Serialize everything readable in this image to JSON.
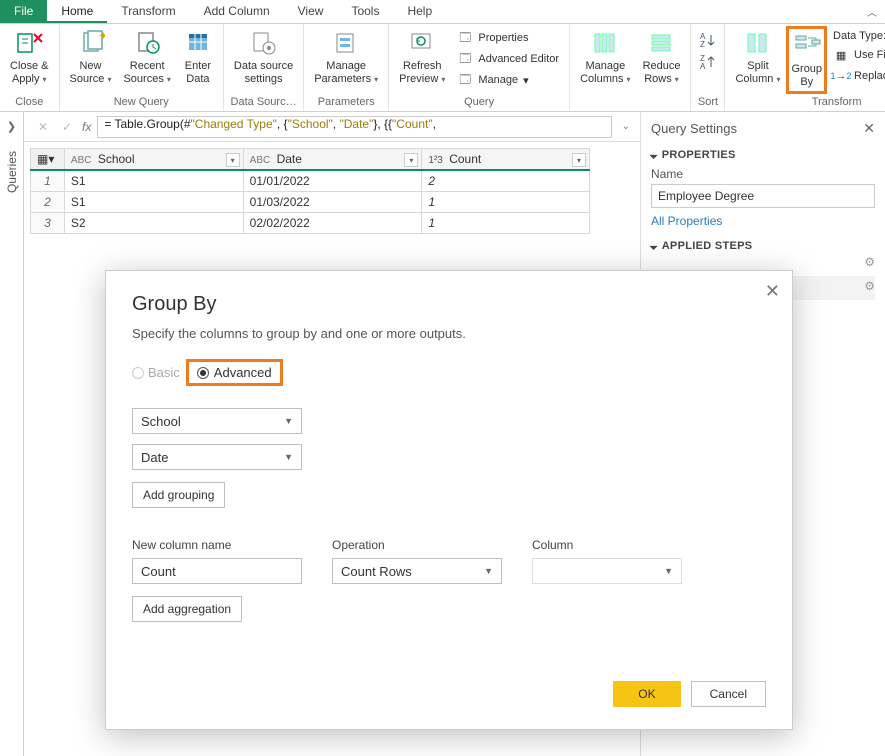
{
  "tabs": {
    "file": "File",
    "items": [
      "Home",
      "Transform",
      "Add Column",
      "View",
      "Tools",
      "Help"
    ],
    "active": 0
  },
  "ribbon": {
    "close": {
      "label1": "Close &",
      "label2": "Apply",
      "drop": "▾"
    },
    "close_group": "Close",
    "new": {
      "label1": "New",
      "label2": "Source",
      "drop": "▾"
    },
    "recent": {
      "label1": "Recent",
      "label2": "Sources",
      "drop": "▾"
    },
    "enter": {
      "label1": "Enter",
      "label2": "Data"
    },
    "newquery_group": "New Query",
    "datasource": {
      "label1": "Data source",
      "label2": "settings"
    },
    "ds_group": "Data Sourc…",
    "params": {
      "label1": "Manage",
      "label2": "Parameters",
      "drop": "▾"
    },
    "params_group": "Parameters",
    "preview": {
      "label1": "Refresh",
      "label2": "Preview",
      "drop": "▾"
    },
    "q_items": {
      "properties": "Properties",
      "advanced": "Advanced Editor",
      "manage": "Manage",
      "drop": "▾"
    },
    "query_group": "Query",
    "mcols": {
      "label1": "Manage",
      "label2": "Columns",
      "drop": "▾"
    },
    "rrows": {
      "label1": "Reduce",
      "label2": "Rows",
      "drop": "▾"
    },
    "sort_group": "Sort",
    "split": {
      "label1": "Split",
      "label2": "Column",
      "drop": "▾"
    },
    "groupby": {
      "label1": "Group",
      "label2": "By"
    },
    "tx_items": {
      "datatype": "Data Type: Whole N",
      "firstrow": "Use First Row as",
      "replace": "Replace Values"
    },
    "tx_group": "Transform"
  },
  "queries_label": "Queries",
  "formula": {
    "prefix": "= Table.Group(#",
    "lit1": "\"Changed Type\"",
    "mid1": ", {",
    "lit2": "\"School\"",
    "mid2": ", ",
    "lit3": "\"Date\"",
    "mid3": "}, {{",
    "lit4": "\"Count\"",
    "suffix": ","
  },
  "grid": {
    "cols": {
      "school": "School",
      "date": "Date",
      "count": "Count"
    },
    "type_abc": "ABC",
    "type_123": "1²3",
    "rows": [
      {
        "n": "1",
        "school": "S1",
        "date": "01/01/2022",
        "count": "2"
      },
      {
        "n": "2",
        "school": "S1",
        "date": "01/03/2022",
        "count": "1"
      },
      {
        "n": "3",
        "school": "S2",
        "date": "02/02/2022",
        "count": "1"
      }
    ]
  },
  "settings": {
    "title": "Query Settings",
    "properties": "PROPERTIES",
    "name_lbl": "Name",
    "name_val": "Employee Degree",
    "allprops": "All Properties",
    "steps": "APPLIED STEPS"
  },
  "dialog": {
    "title": "Group By",
    "subtitle": "Specify the columns to group by and one or more outputs.",
    "basic": "Basic",
    "advanced": "Advanced",
    "group1": "School",
    "group2": "Date",
    "add_grouping": "Add grouping",
    "hdr_newcol": "New column name",
    "hdr_op": "Operation",
    "hdr_col": "Column",
    "newcol_val": "Count",
    "op_val": "Count Rows",
    "add_agg": "Add aggregation",
    "ok": "OK",
    "cancel": "Cancel"
  }
}
